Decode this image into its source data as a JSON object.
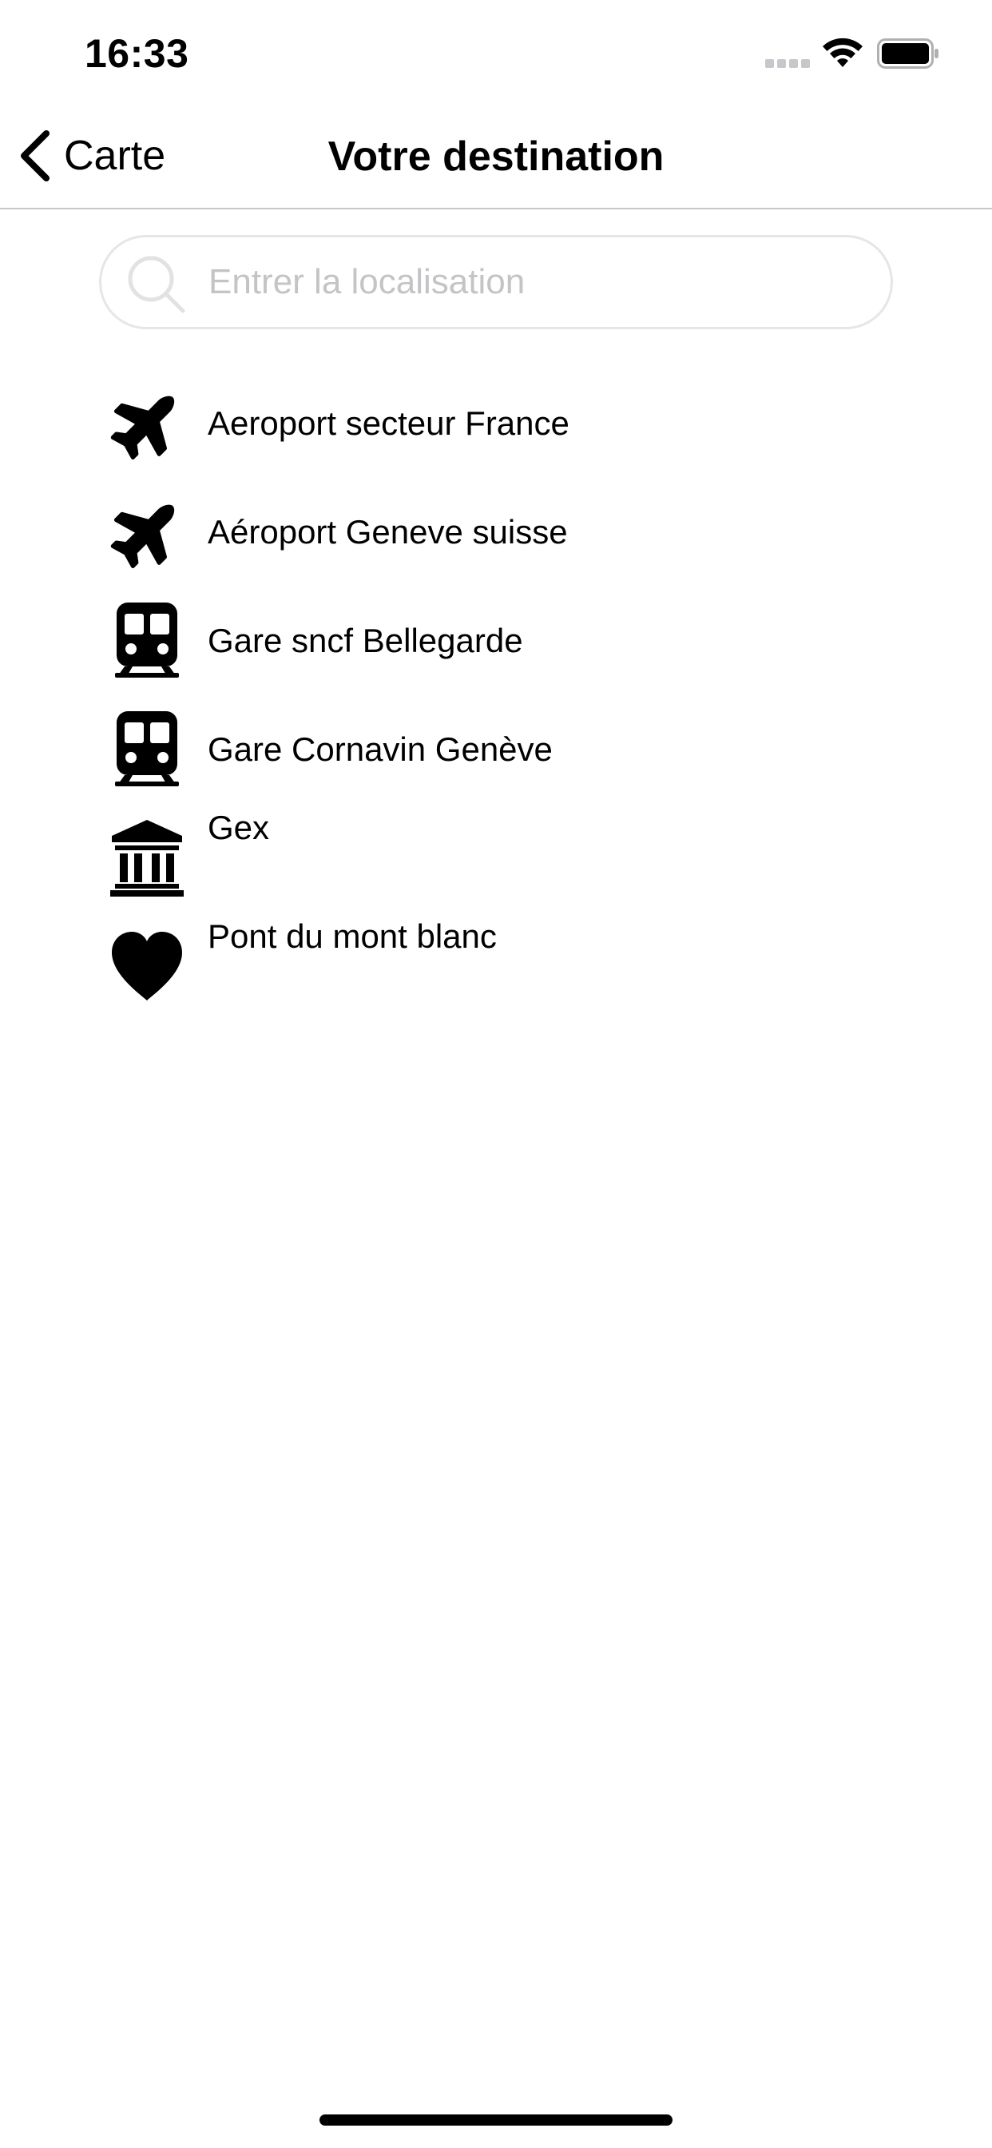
{
  "status_bar": {
    "time": "16:33"
  },
  "nav": {
    "back_label": "Carte",
    "title": "Votre destination"
  },
  "search": {
    "placeholder": "Entrer la localisation",
    "value": ""
  },
  "destinations": [
    {
      "label": "Aeroport secteur France",
      "icon": "airplane-icon"
    },
    {
      "label": "Aéroport Geneve suisse",
      "icon": "airplane-icon"
    },
    {
      "label": "Gare sncf Bellegarde",
      "icon": "train-icon"
    },
    {
      "label": "Gare Cornavin Genève",
      "icon": "train-icon"
    },
    {
      "label": "Gex",
      "icon": "bank-icon"
    },
    {
      "label": "Pont du mont blanc",
      "icon": "heart-icon"
    }
  ],
  "colors": {
    "text": "#000000",
    "placeholder": "#c4c4c7",
    "search_border": "#e6e6e8",
    "separator": "#c8c8cc",
    "background": "#ffffff"
  }
}
